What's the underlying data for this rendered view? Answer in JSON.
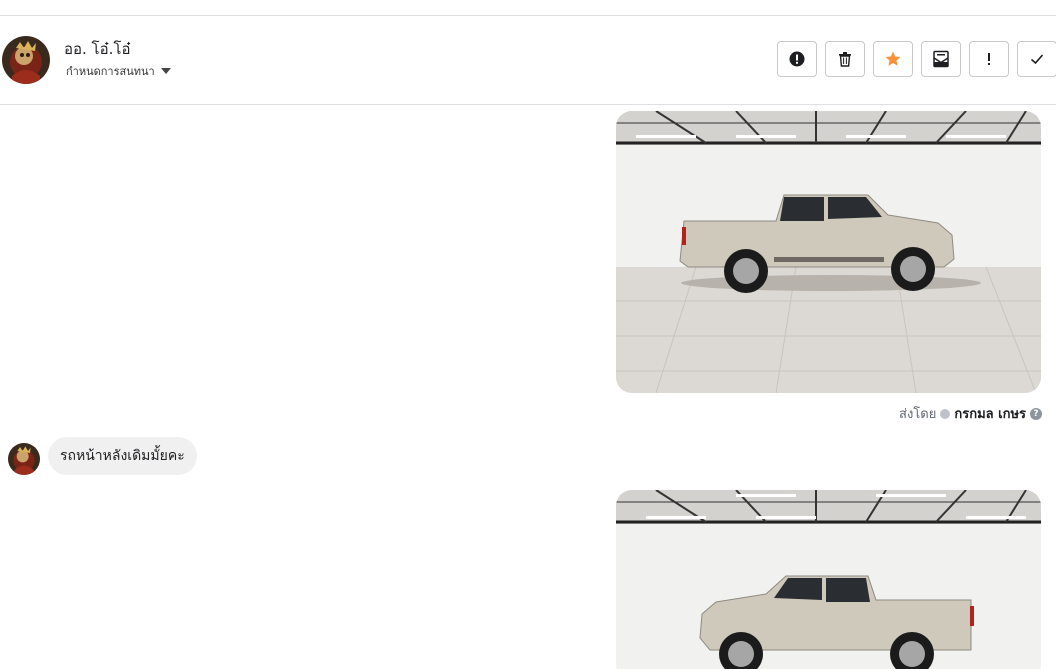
{
  "header": {
    "contact_name": "ออ. โอ๋.โอ๋",
    "subtitle": "กำหนดการสนทนา"
  },
  "toolbar": {
    "buttons": [
      {
        "icon": "alert-circle-icon"
      },
      {
        "icon": "trash-icon"
      },
      {
        "icon": "star-icon",
        "color": "#f7923b"
      },
      {
        "icon": "mail-archive-icon"
      },
      {
        "icon": "exclamation-icon"
      },
      {
        "icon": "check-icon"
      }
    ]
  },
  "messages": [
    {
      "type": "image",
      "sender": "outgoing",
      "content": "photo of silver pickup truck in showroom (side view facing right)"
    },
    {
      "type": "meta",
      "sent_by_label": "ส่งโดย",
      "sent_by_name": "กรกมล เกษร",
      "help": "?"
    },
    {
      "type": "text",
      "sender": "incoming",
      "text": "รถหน้าหลังเดิมมั้ยคะ"
    },
    {
      "type": "image",
      "sender": "outgoing",
      "content": "photo of silver pickup truck in showroom (side view facing left)"
    }
  ]
}
